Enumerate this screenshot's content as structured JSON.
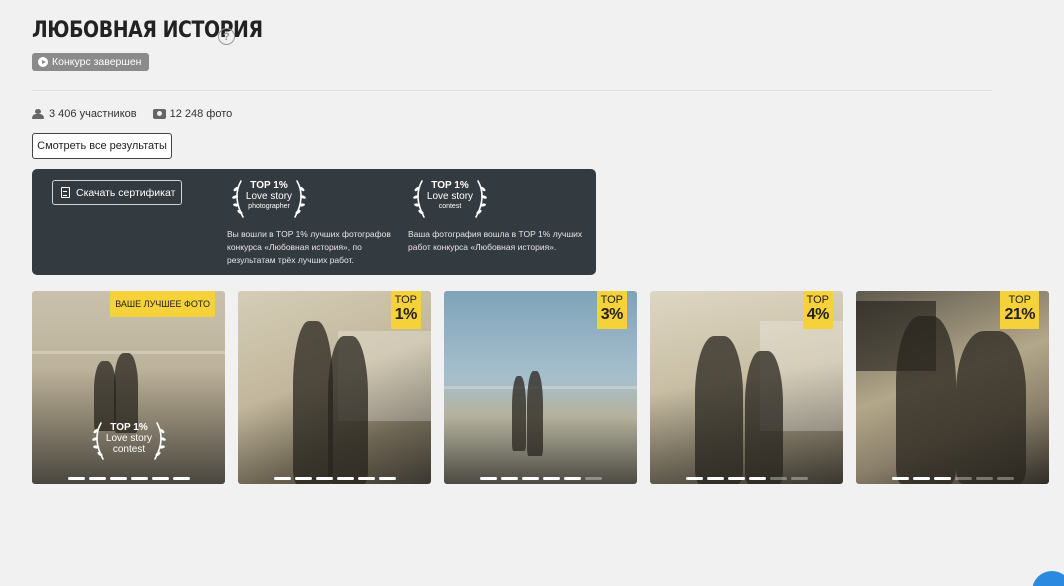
{
  "header": {
    "title": "ЛЮБОВНАЯ ИСТОРИЯ",
    "help_icon": "?",
    "status": "Конкурс завершен"
  },
  "stats": {
    "participants": "3 406 участников",
    "photos": "12 248 фото"
  },
  "results_button": "Смотреть все результаты",
  "certificate": {
    "button": "Скачать сертификат",
    "awards": [
      {
        "line1": "TOP 1%",
        "line2": "Love story",
        "line3": "photographer",
        "desc": "Вы вошли в TOP 1% лучших фотографов конкурса «Любовная история», по результатам трёх лучших работ."
      },
      {
        "line1": "TOP 1%",
        "line2": "Love story",
        "line3": "contest",
        "desc": "Ваша фотография вошла в TOP 1% лучших работ конкурса «Любовная история»."
      }
    ]
  },
  "photos": [
    {
      "badge": "ВАШЕ ЛУЧШЕЕ ФОТО",
      "laurel": {
        "line1": "TOP 1%",
        "line2": "Love story",
        "line3": "contest"
      },
      "pager_active": 6,
      "pager_total": 6
    },
    {
      "top_label": "TOP",
      "top_value": "1%",
      "pager_active": 6,
      "pager_total": 6
    },
    {
      "top_label": "TOP",
      "top_value": "3%",
      "pager_active": 5,
      "pager_total": 6
    },
    {
      "top_label": "TOP",
      "top_value": "4%",
      "pager_active": 4,
      "pager_total": 6
    },
    {
      "top_label": "TOP",
      "top_value": "21%",
      "pager_active": 3,
      "pager_total": 6
    }
  ],
  "colors": {
    "background": "#f1f1f1",
    "panel": "#333a40",
    "badge_yellow": "#f5d13a",
    "status_gray": "#8b8b8b",
    "chat_blue": "#2b8ae0"
  }
}
